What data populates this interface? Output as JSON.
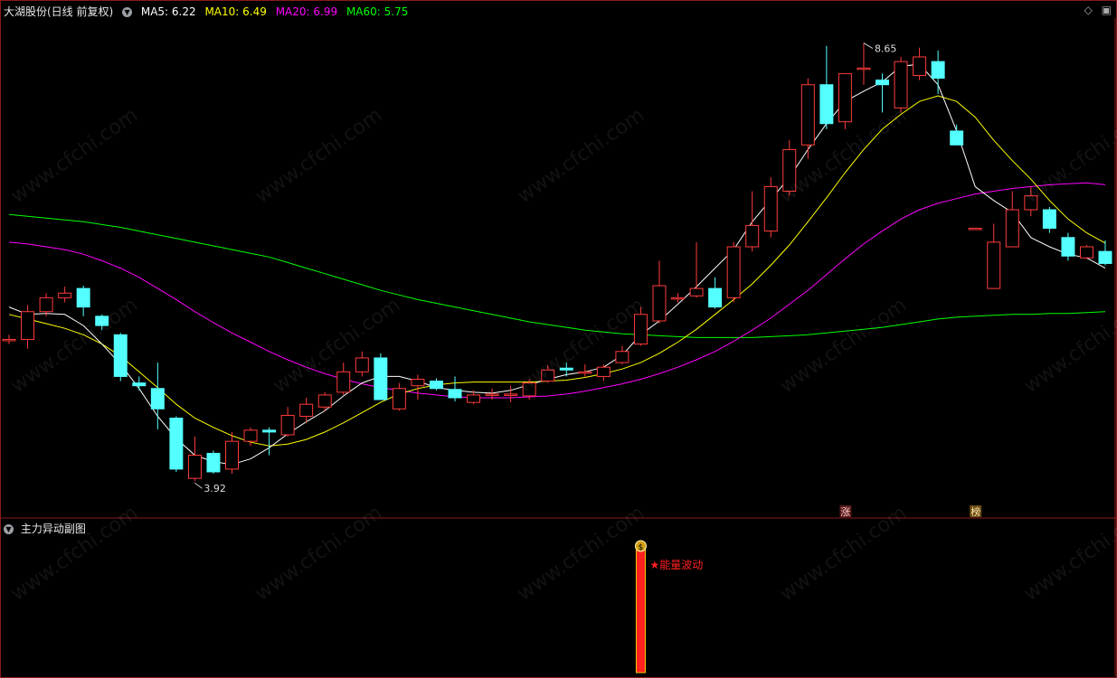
{
  "header": {
    "stock_title": "大湖股份(日线 前复权)",
    "ma5_label": "MA5: 6.22",
    "ma10_label": "MA10: 6.49",
    "ma20_label": "MA20: 6.99",
    "ma60_label": "MA60: 5.75"
  },
  "sub_panel": {
    "title": "主力异动副图",
    "signal_label": "★能量波动",
    "signal_icon_text": "$"
  },
  "markers": {
    "zhang": "涨",
    "bang": "榜"
  },
  "watermark_text": "www.cfchi.com",
  "colors": {
    "up": "#ff3b3b",
    "down": "#54ffff",
    "ma5": "#ffffff",
    "ma10": "#ffff00",
    "ma20": "#ff00ff",
    "ma60": "#00ff00",
    "frame": "#8a1a1a",
    "signal": "#ff2020"
  },
  "chart_data": {
    "type": "candlestick",
    "price_annotations": {
      "high": "8.65",
      "low": "3.92"
    },
    "ylim": [
      3.6,
      8.9
    ],
    "candles": [
      {
        "o": 5.45,
        "c": 5.45,
        "h": 5.5,
        "l": 5.4
      },
      {
        "o": 5.45,
        "c": 5.75,
        "h": 5.82,
        "l": 5.35
      },
      {
        "o": 5.75,
        "c": 5.9,
        "h": 5.95,
        "l": 5.7
      },
      {
        "o": 5.9,
        "c": 5.95,
        "h": 6.02,
        "l": 5.85
      },
      {
        "o": 6.0,
        "c": 5.8,
        "h": 6.03,
        "l": 5.7
      },
      {
        "o": 5.7,
        "c": 5.6,
        "h": 5.72,
        "l": 5.55
      },
      {
        "o": 5.5,
        "c": 5.05,
        "h": 5.52,
        "l": 5.0
      },
      {
        "o": 4.98,
        "c": 4.95,
        "h": 5.05,
        "l": 4.9
      },
      {
        "o": 4.92,
        "c": 4.7,
        "h": 5.2,
        "l": 4.48
      },
      {
        "o": 4.6,
        "c": 4.05,
        "h": 4.62,
        "l": 4.02
      },
      {
        "o": 3.95,
        "c": 4.2,
        "h": 4.4,
        "l": 3.92
      },
      {
        "o": 4.22,
        "c": 4.02,
        "h": 4.25,
        "l": 4.0
      },
      {
        "o": 4.05,
        "c": 4.35,
        "h": 4.45,
        "l": 4.0
      },
      {
        "o": 4.35,
        "c": 4.47,
        "h": 4.5,
        "l": 4.3
      },
      {
        "o": 4.47,
        "c": 4.45,
        "h": 4.5,
        "l": 4.2
      },
      {
        "o": 4.42,
        "c": 4.63,
        "h": 4.72,
        "l": 4.4
      },
      {
        "o": 4.62,
        "c": 4.75,
        "h": 4.82,
        "l": 4.55
      },
      {
        "o": 4.72,
        "c": 4.85,
        "h": 4.88,
        "l": 4.68
      },
      {
        "o": 4.88,
        "c": 5.1,
        "h": 5.2,
        "l": 4.85
      },
      {
        "o": 5.1,
        "c": 5.25,
        "h": 5.32,
        "l": 5.05
      },
      {
        "o": 5.25,
        "c": 4.8,
        "h": 5.3,
        "l": 4.8
      },
      {
        "o": 4.7,
        "c": 4.92,
        "h": 4.98,
        "l": 4.68
      },
      {
        "o": 4.95,
        "c": 5.02,
        "h": 5.07,
        "l": 4.8
      },
      {
        "o": 5.0,
        "c": 4.92,
        "h": 5.03,
        "l": 4.9
      },
      {
        "o": 4.91,
        "c": 4.82,
        "h": 5.05,
        "l": 4.78
      },
      {
        "o": 4.77,
        "c": 4.85,
        "h": 4.9,
        "l": 4.75
      },
      {
        "o": 4.86,
        "c": 4.86,
        "h": 4.92,
        "l": 4.8
      },
      {
        "o": 4.86,
        "c": 4.86,
        "h": 4.95,
        "l": 4.77
      },
      {
        "o": 4.84,
        "c": 4.98,
        "h": 5.02,
        "l": 4.8
      },
      {
        "o": 5.0,
        "c": 5.12,
        "h": 5.17,
        "l": 4.98
      },
      {
        "o": 5.14,
        "c": 5.12,
        "h": 5.2,
        "l": 5.05
      },
      {
        "o": 5.1,
        "c": 5.1,
        "h": 5.18,
        "l": 5.05
      },
      {
        "o": 5.05,
        "c": 5.15,
        "h": 5.18,
        "l": 5.0
      },
      {
        "o": 5.2,
        "c": 5.32,
        "h": 5.38,
        "l": 5.18
      },
      {
        "o": 5.4,
        "c": 5.72,
        "h": 5.8,
        "l": 5.38
      },
      {
        "o": 5.65,
        "c": 6.03,
        "h": 6.3,
        "l": 5.62
      },
      {
        "o": 5.9,
        "c": 5.9,
        "h": 5.95,
        "l": 5.85
      },
      {
        "o": 5.92,
        "c": 6.0,
        "h": 6.5,
        "l": 5.9
      },
      {
        "o": 6.0,
        "c": 5.8,
        "h": 6.12,
        "l": 5.78
      },
      {
        "o": 5.9,
        "c": 6.45,
        "h": 6.5,
        "l": 5.85
      },
      {
        "o": 6.45,
        "c": 6.68,
        "h": 7.05,
        "l": 6.4
      },
      {
        "o": 6.62,
        "c": 7.1,
        "h": 7.2,
        "l": 6.55
      },
      {
        "o": 7.05,
        "c": 7.5,
        "h": 7.6,
        "l": 7.0
      },
      {
        "o": 7.55,
        "c": 8.2,
        "h": 8.27,
        "l": 7.4
      },
      {
        "o": 8.2,
        "c": 7.78,
        "h": 8.62,
        "l": 7.72
      },
      {
        "o": 7.8,
        "c": 8.32,
        "h": 8.32,
        "l": 7.72
      },
      {
        "o": 8.38,
        "c": 8.38,
        "h": 8.65,
        "l": 8.2
      },
      {
        "o": 8.25,
        "c": 8.2,
        "h": 8.32,
        "l": 7.9
      },
      {
        "o": 7.95,
        "c": 8.45,
        "h": 8.5,
        "l": 7.9
      },
      {
        "o": 8.3,
        "c": 8.5,
        "h": 8.6,
        "l": 8.25
      },
      {
        "o": 8.45,
        "c": 8.27,
        "h": 8.57,
        "l": 8.1
      },
      {
        "o": 7.7,
        "c": 7.55,
        "h": 7.77,
        "l": 7.55
      },
      {
        "o": 6.65,
        "c": 6.65,
        "h": 6.65,
        "l": 6.65
      },
      {
        "o": 6.0,
        "c": 6.5,
        "h": 6.7,
        "l": 6.0
      },
      {
        "o": 6.45,
        "c": 6.85,
        "h": 7.05,
        "l": 6.45
      },
      {
        "o": 6.85,
        "c": 7.0,
        "h": 7.1,
        "l": 6.78
      },
      {
        "o": 6.85,
        "c": 6.65,
        "h": 6.88,
        "l": 6.6
      },
      {
        "o": 6.55,
        "c": 6.35,
        "h": 6.6,
        "l": 6.3
      },
      {
        "o": 6.33,
        "c": 6.45,
        "h": 6.47,
        "l": 6.32
      },
      {
        "o": 6.4,
        "c": 6.27,
        "h": 6.52,
        "l": 6.25
      }
    ],
    "ma5": [
      5.8,
      5.72,
      5.73,
      5.72,
      5.6,
      5.4,
      5.18,
      4.92,
      4.62,
      4.38,
      4.2,
      4.13,
      4.1,
      4.16,
      4.28,
      4.43,
      4.56,
      4.68,
      4.84,
      4.98,
      5.05,
      5.05,
      5.0,
      4.93,
      4.9,
      4.88,
      4.87,
      4.9,
      4.96,
      5.02,
      5.07,
      5.1,
      5.15,
      5.28,
      5.5,
      5.65,
      5.83,
      6.02,
      6.22,
      6.42,
      6.72,
      6.96,
      7.2,
      7.5,
      7.78,
      8.02,
      8.13,
      8.23,
      8.4,
      8.42,
      8.2,
      7.7,
      7.1,
      6.95,
      6.82,
      6.55,
      6.45,
      6.37,
      6.33,
      6.22
    ],
    "ma10": [
      5.72,
      5.67,
      5.62,
      5.57,
      5.5,
      5.4,
      5.27,
      5.1,
      4.93,
      4.75,
      4.6,
      4.5,
      4.41,
      4.34,
      4.3,
      4.32,
      4.37,
      4.45,
      4.55,
      4.66,
      4.77,
      4.86,
      4.92,
      4.96,
      4.98,
      4.99,
      4.99,
      4.99,
      4.99,
      5.0,
      5.01,
      5.04,
      5.08,
      5.13,
      5.2,
      5.3,
      5.42,
      5.56,
      5.72,
      5.88,
      6.05,
      6.25,
      6.47,
      6.72,
      6.98,
      7.25,
      7.5,
      7.72,
      7.88,
      8.02,
      8.08,
      8.02,
      7.85,
      7.6,
      7.38,
      7.18,
      6.95,
      6.75,
      6.6,
      6.49
    ],
    "ma20": [
      6.5,
      6.48,
      6.45,
      6.42,
      6.37,
      6.3,
      6.22,
      6.12,
      6.0,
      5.88,
      5.75,
      5.63,
      5.52,
      5.42,
      5.32,
      5.23,
      5.15,
      5.08,
      5.02,
      4.97,
      4.93,
      4.9,
      4.87,
      4.85,
      4.83,
      4.82,
      4.82,
      4.82,
      4.83,
      4.84,
      4.86,
      4.89,
      4.93,
      4.97,
      5.02,
      5.08,
      5.15,
      5.23,
      5.32,
      5.43,
      5.55,
      5.68,
      5.83,
      5.98,
      6.15,
      6.32,
      6.48,
      6.62,
      6.75,
      6.85,
      6.92,
      6.97,
      7.02,
      7.05,
      7.08,
      7.1,
      7.12,
      7.13,
      7.14,
      7.12
    ],
    "ma60": [
      6.8,
      6.78,
      6.76,
      6.74,
      6.72,
      6.69,
      6.66,
      6.62,
      6.58,
      6.54,
      6.5,
      6.46,
      6.42,
      6.38,
      6.34,
      6.28,
      6.22,
      6.16,
      6.1,
      6.04,
      5.98,
      5.93,
      5.88,
      5.84,
      5.8,
      5.76,
      5.72,
      5.68,
      5.64,
      5.61,
      5.58,
      5.55,
      5.53,
      5.51,
      5.5,
      5.49,
      5.48,
      5.47,
      5.47,
      5.47,
      5.47,
      5.48,
      5.49,
      5.5,
      5.52,
      5.54,
      5.56,
      5.58,
      5.61,
      5.64,
      5.67,
      5.69,
      5.7,
      5.71,
      5.72,
      5.72,
      5.73,
      5.73,
      5.74,
      5.75
    ],
    "signal_bar_index": 34
  }
}
